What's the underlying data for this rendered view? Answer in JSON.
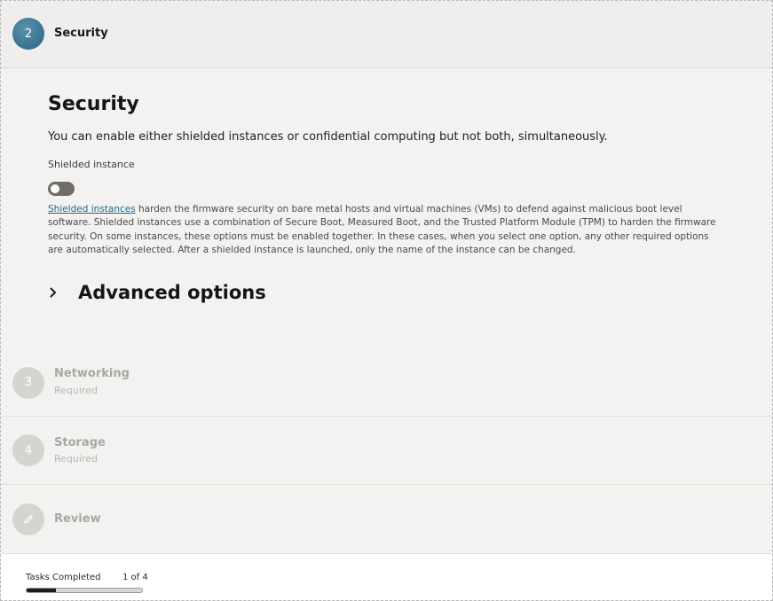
{
  "active_step": {
    "number": "2",
    "title": "Security"
  },
  "security": {
    "heading": "Security",
    "description": "You can enable either shielded instances or confidential computing but not both, simultaneously.",
    "shielded_label": "Shielded instance",
    "shielded_enabled": false,
    "help_link": "Shielded instances",
    "help_text": " harden the firmware security on bare metal hosts and virtual machines (VMs) to defend against malicious boot level software. Shielded instances use a combination of Secure Boot, Measured Boot, and the Trusted Platform Module (TPM) to harden the firmware security. On some instances, these options must be enabled together. In these cases, when you select one option, any other required options are automatically selected. After a shielded instance is launched, only the name of the instance can be changed."
  },
  "advanced": {
    "label": "Advanced options"
  },
  "steps": [
    {
      "number": "3",
      "name": "Networking",
      "sub": "Required"
    },
    {
      "number": "4",
      "name": "Storage",
      "sub": "Required"
    },
    {
      "icon": "pencil-icon",
      "name": "Review"
    }
  ],
  "footer": {
    "tasks_label": "Tasks Completed",
    "tasks_count": "1 of 4",
    "progress_fraction": 0.25
  },
  "colors": {
    "active_step": "#3e7894",
    "link": "#1b6a8f",
    "progress": "#1c1b1a"
  }
}
